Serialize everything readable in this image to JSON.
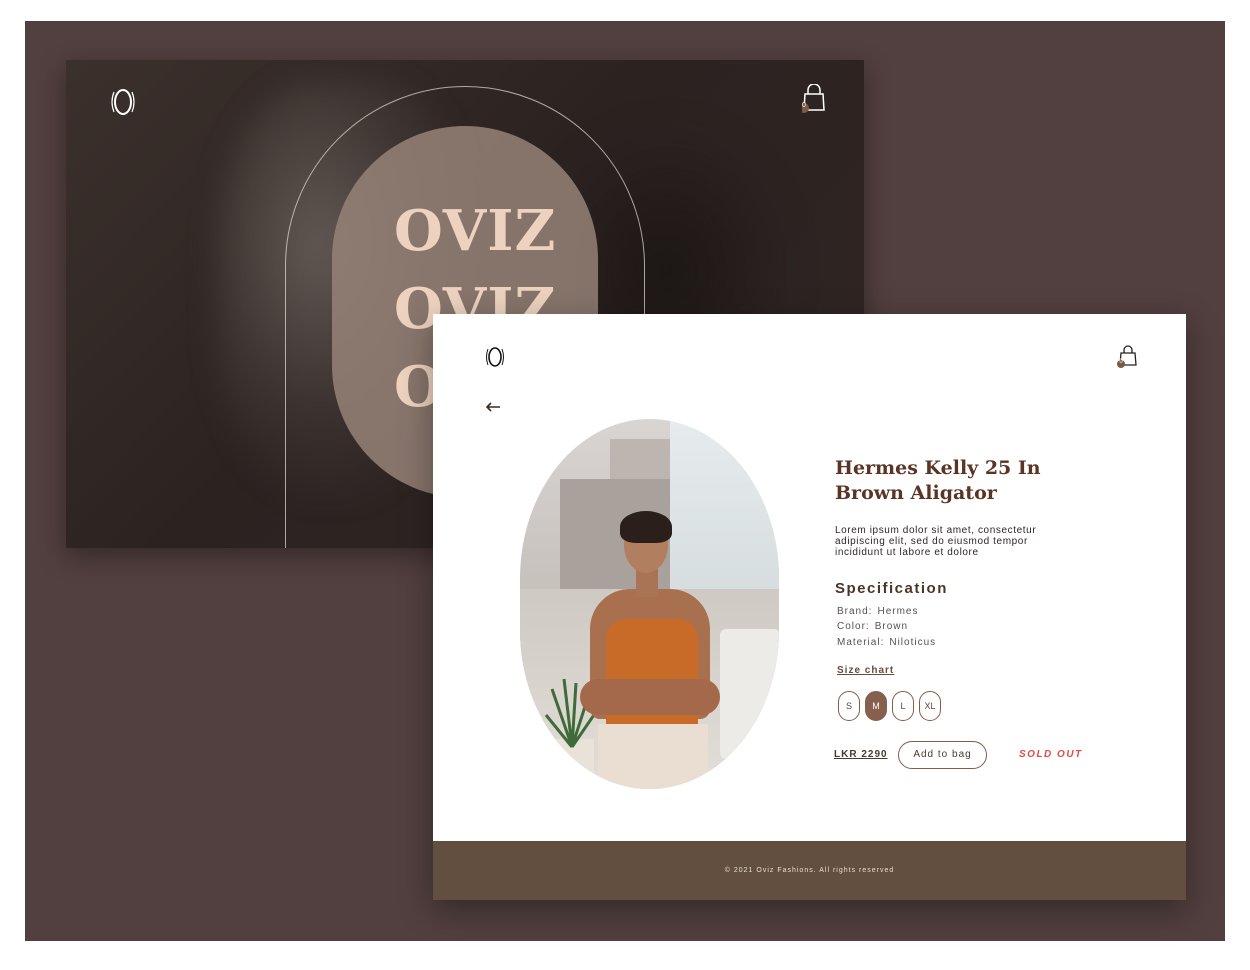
{
  "hero": {
    "brand_words": [
      "OVIZ",
      "OVIZ",
      "OVIZ"
    ],
    "cart_count": "0"
  },
  "header": {
    "cart_count": "0"
  },
  "product": {
    "title": "Hermes Kelly 25 In Brown Aligator",
    "description": "Lorem ipsum dolor sit amet, consectetur adipiscing elit, sed do eiusmod tempor incididunt ut labore et dolore",
    "spec_heading": "Specification",
    "specs": [
      {
        "key": "Brand:",
        "value": "Hermes"
      },
      {
        "key": "Color:",
        "value": "Brown"
      },
      {
        "key": "Material:",
        "value": "Niloticus"
      }
    ],
    "size_chart_label": "Size chart",
    "sizes": [
      {
        "label": "S",
        "selected": false
      },
      {
        "label": "M",
        "selected": true
      },
      {
        "label": "L",
        "selected": false
      },
      {
        "label": "XL",
        "selected": false
      }
    ],
    "price": "LKR 2290",
    "add_to_bag_label": "Add to bag",
    "status": "SOLD OUT"
  },
  "footer": {
    "copyright": "© 2021 Oviz Fashions. All rights reserved"
  },
  "colors": {
    "backdrop": "#523f3f",
    "accent_brown": "#87604d",
    "footer": "#634f3f",
    "sold_out": "#e24a4a",
    "hero_word": "#ecd2bf"
  },
  "icons": [
    "logo-icon",
    "shopping-bag-icon",
    "back-arrow-icon"
  ]
}
